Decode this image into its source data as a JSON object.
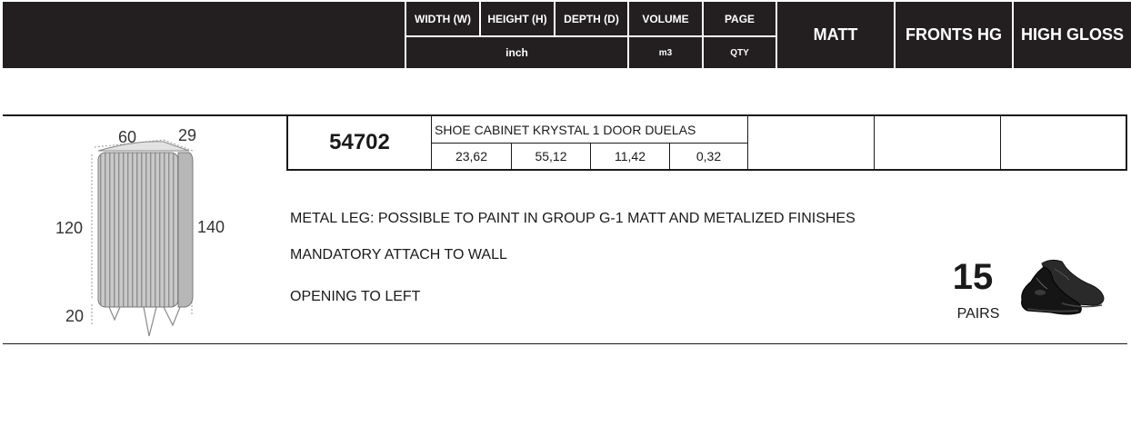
{
  "header": {
    "width_label": "WIDTH (W)",
    "height_label": "HEIGHT (H)",
    "depth_label": "DEPTH (D)",
    "volume_label": "VOLUME",
    "page_label": "PAGE",
    "unit_inch": "inch",
    "unit_m3": "m3",
    "qty_label": "QTY",
    "matt_label": "MATT",
    "fronts_hg_label": "FRONTS HG",
    "high_gloss_label": "HIGH GLOSS"
  },
  "product": {
    "code": "54702",
    "name": "SHOE CABINET KRYSTAL 1 DOOR DUELAS",
    "width": "23,62",
    "height": "55,12",
    "depth": "11,42",
    "volume": "0,32",
    "matt_price": "",
    "fronts_hg_price": "",
    "high_gloss_price": ""
  },
  "drawing": {
    "dim_width": "60",
    "dim_depth": "29",
    "dim_height_body": "120",
    "dim_height_total": "140",
    "dim_leg": "20"
  },
  "notes": [
    "METAL LEG: POSSIBLE TO PAINT IN GROUP G-1 MATT AND METALIZED FINISHES",
    "MANDATORY ATTACH TO WALL",
    "OPENING TO LEFT"
  ],
  "capacity": {
    "value": "15",
    "unit": "PAIRS",
    "icon": "shoes-icon"
  },
  "colors": {
    "header_bg": "#231f20",
    "header_text": "#ffffff",
    "line": "#1a1a1a"
  }
}
